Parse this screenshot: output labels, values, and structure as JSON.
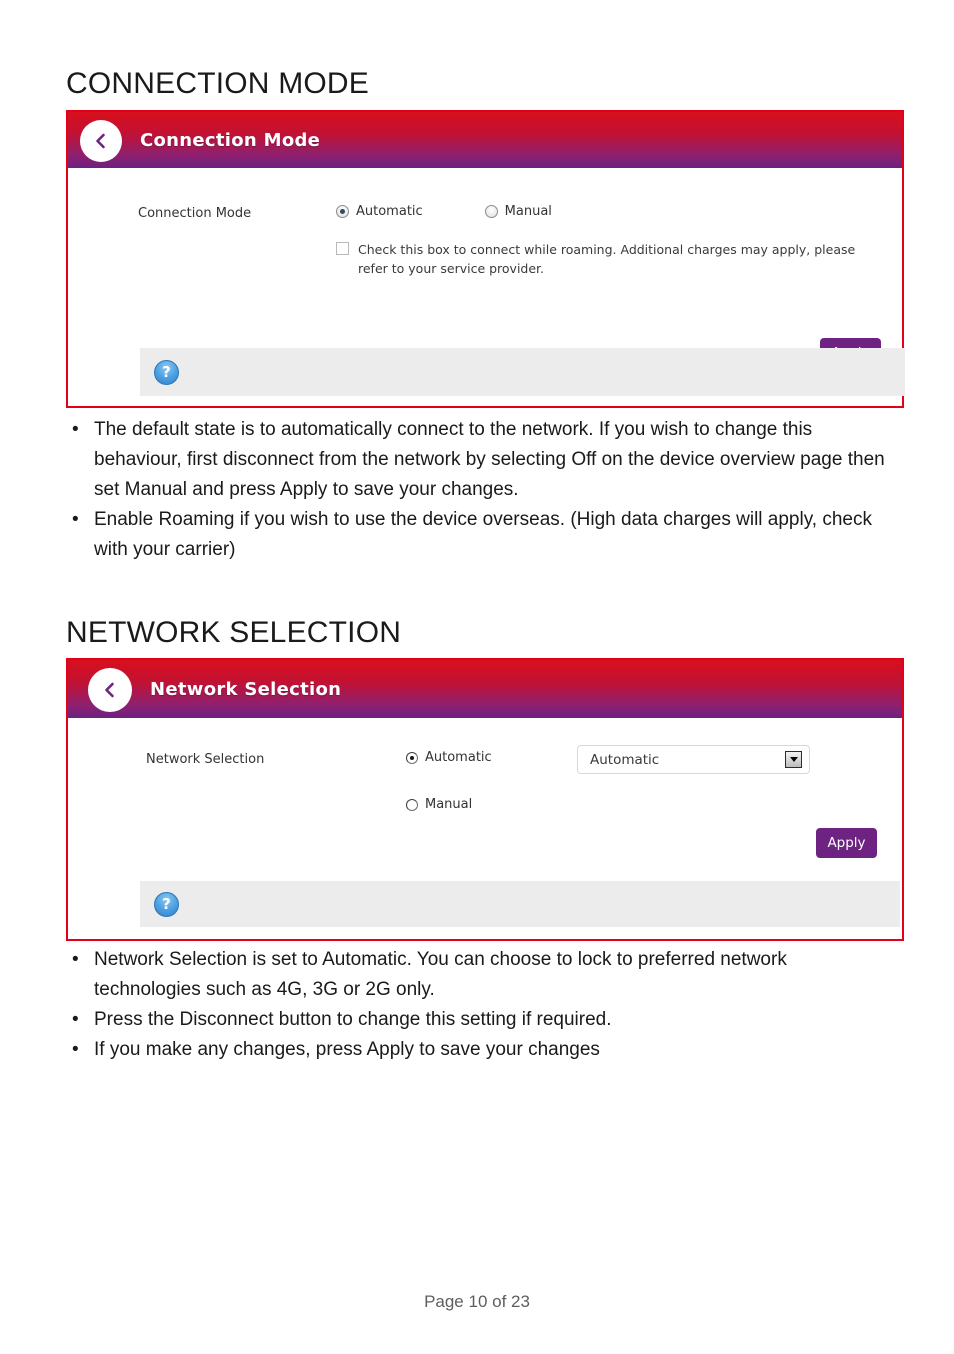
{
  "document": {
    "footer": "Page 10 of 23"
  },
  "sections": [
    {
      "heading": "CONNECTION MODE",
      "panel": {
        "title": "Connection Mode",
        "back_icon": "chevron-left-icon",
        "help_icon": "question-mark-icon",
        "field_label": "Connection Mode",
        "radios": [
          {
            "label": "Automatic",
            "checked": true
          },
          {
            "label": "Manual",
            "checked": false
          }
        ],
        "checkbox": {
          "checked": false,
          "text": "Check this box to connect while roaming. Additional charges may apply, please refer to your service provider."
        },
        "apply_label": "Apply"
      },
      "bullets": [
        "The default state is to automatically connect to the network. If you wish to change this behaviour, first disconnect from the network by selecting Off on the device overview page then set Manual and press Apply to save your changes.",
        "Enable Roaming if you wish to use the device overseas. (High data charges will apply, check with your carrier)"
      ]
    },
    {
      "heading": "NETWORK SELECTION",
      "panel": {
        "title": "Network Selection",
        "back_icon": "chevron-left-icon",
        "help_icon": "question-mark-icon",
        "field_label": "Network Selection",
        "radios": [
          {
            "label": "Automatic",
            "checked": true
          },
          {
            "label": "Manual",
            "checked": false
          }
        ],
        "select": {
          "value": "Automatic",
          "arrow_icon": "caret-down-icon"
        },
        "apply_label": "Apply"
      },
      "bullets": [
        "Network Selection is set to Automatic. You can choose to lock to preferred network technologies such as 4G, 3G or 2G only.",
        "Press the Disconnect button to change this setting if required.",
        "If you make any changes, press Apply to save your changes"
      ]
    }
  ],
  "colors": {
    "panel_border": "#e50019",
    "header_gradient_start": "#d8101d",
    "header_gradient_end": "#6c2080",
    "apply_button": "#6e2382",
    "help_bar": "#ececec",
    "help_icon": "#4fa3e3"
  }
}
